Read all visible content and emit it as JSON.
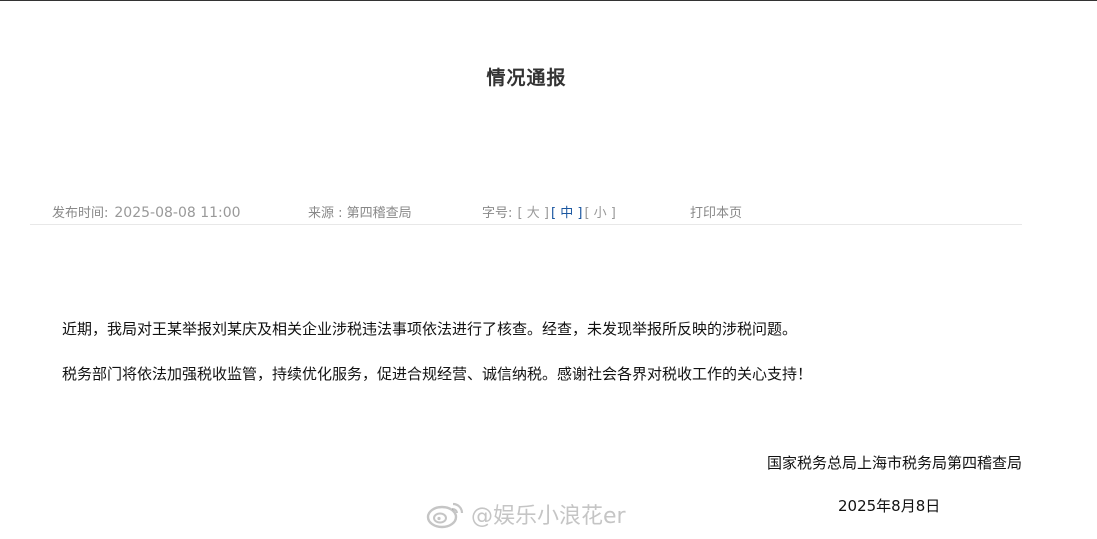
{
  "title": "情况通报",
  "meta": {
    "publish_label": "发布时间:",
    "publish_value": "2025-08-08 11:00",
    "source": "来源 : 第四稽查局",
    "fontsize_label": "字号:",
    "fontsize_options": [
      "大",
      "中",
      "小"
    ],
    "fontsize_selected": "中",
    "print": "打印本页"
  },
  "body": {
    "paragraph1": "近期，我局对王某举报刘某庆及相关企业涉税违法事项依法进行了核查。经查，未发现举报所反映的涉税问题。",
    "paragraph2": "税务部门将依法加强税收监管，持续优化服务，促进合规经营、诚信纳税。感谢社会各界对税收工作的关心支持！"
  },
  "signature": {
    "org": "国家税务总局上海市税务局第四稽查局",
    "date": "2025年8月8日"
  },
  "watermark": {
    "text": "@娱乐小浪花er",
    "icon": "weibo-icon"
  }
}
